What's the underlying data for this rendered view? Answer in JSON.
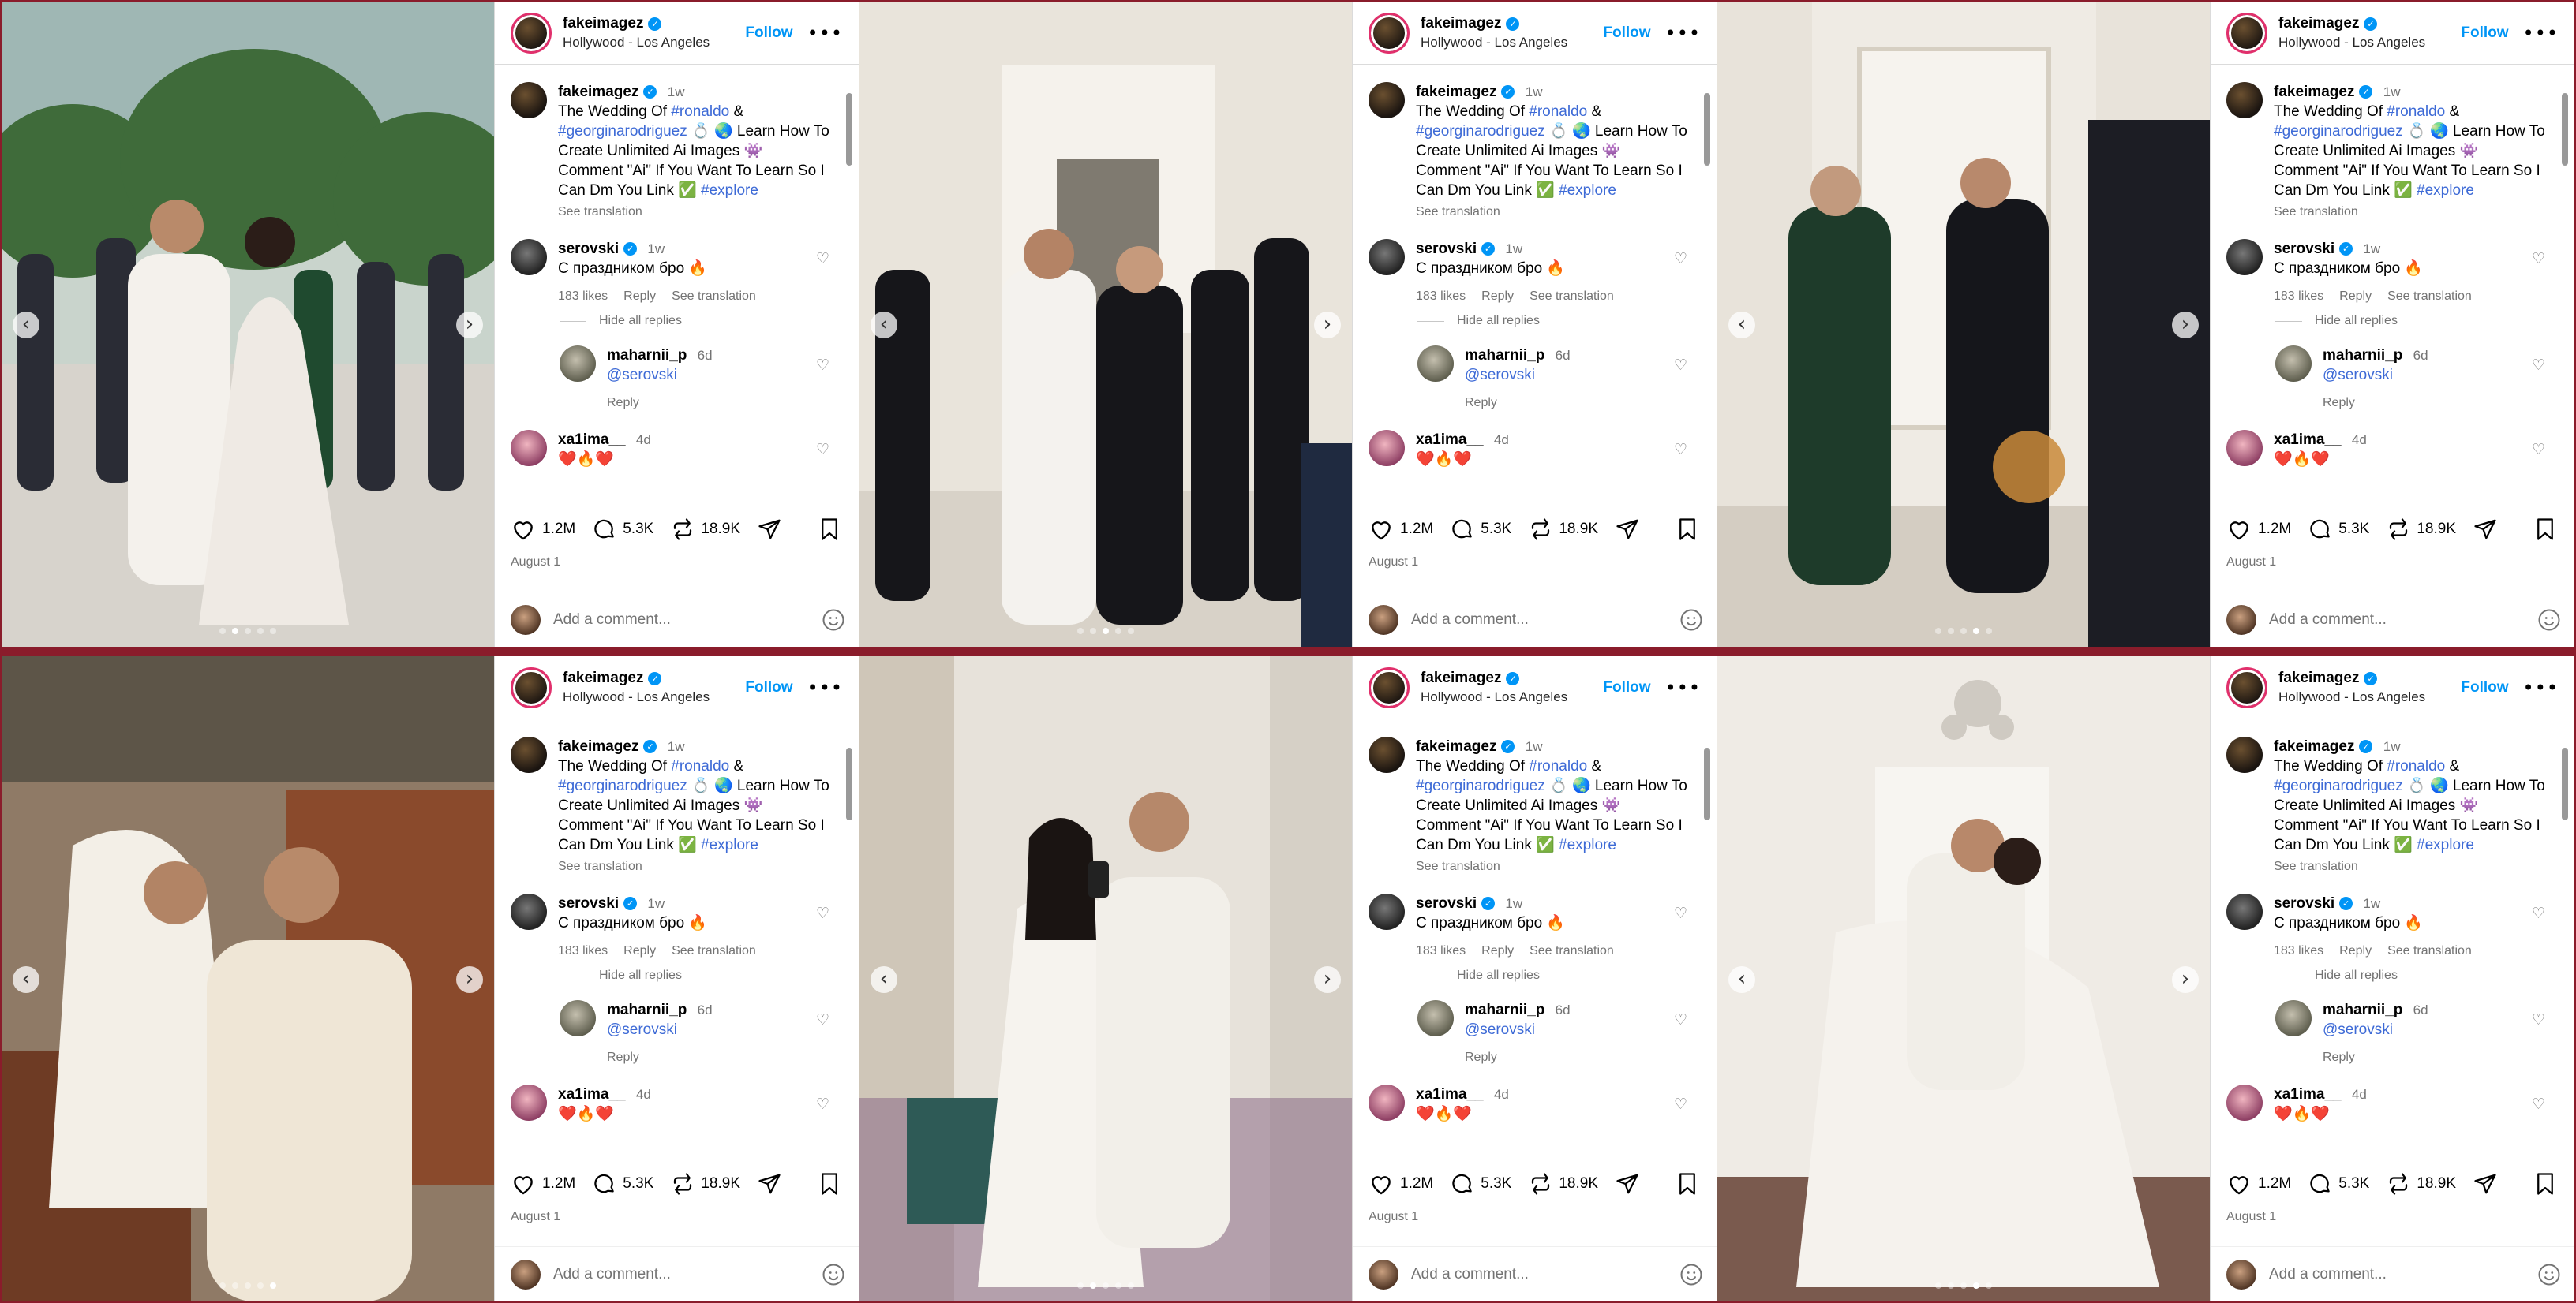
{
  "post": {
    "username": "fakeimagez",
    "location": "Hollywood - Los Angeles",
    "follow_label": "Follow",
    "more_label": "•••",
    "caption": {
      "time": "1w",
      "text_1": "The Wedding Of ",
      "tag_1": "#ronaldo",
      "text_2": " & ",
      "tag_2": "#georginarodriguez",
      "text_3": " 💍 🌏 Learn How To Create Unlimited Ai Images 👾 Comment \"Ai\" If You Want To Learn So I Can Dm You Link ✅ ",
      "tag_3": "#explore",
      "see_translation": "See translation"
    },
    "comments": [
      {
        "username": "serovski",
        "time": "1w",
        "text": "С праздником бро 🔥",
        "likes": "183 likes",
        "reply_label": "Reply",
        "see_translation": "See translation",
        "hide_replies": "Hide all replies"
      }
    ],
    "reply_comment": {
      "username": "maharnii_p",
      "time": "6d",
      "mention": "@serovski",
      "reply_label": "Reply"
    },
    "third_comment": {
      "username": "xa1ima__",
      "time": "4d",
      "text": "❤️🔥❤️"
    },
    "stats": {
      "likes": "1.2M",
      "comments": "5.3K",
      "reposts": "18.9K"
    },
    "date": "August 1",
    "comment_placeholder": "Add a comment..."
  },
  "nav": {
    "prev": "‹",
    "next": "›"
  },
  "photos": [
    {
      "scene": "garden-walk",
      "active_dot": 1
    },
    {
      "scene": "hallway-group",
      "active_dot": 2
    },
    {
      "scene": "hallway-scuffle",
      "active_dot": 3
    },
    {
      "scene": "car-rings",
      "active_dot": 4
    },
    {
      "scene": "mirror-selfie",
      "active_dot": 1
    },
    {
      "scene": "corridor-kiss",
      "active_dot": 3
    }
  ],
  "colors": {
    "accent_link": "#3d6ad6",
    "follow_blue": "#0095f6",
    "separator": "#8a1c2b"
  }
}
